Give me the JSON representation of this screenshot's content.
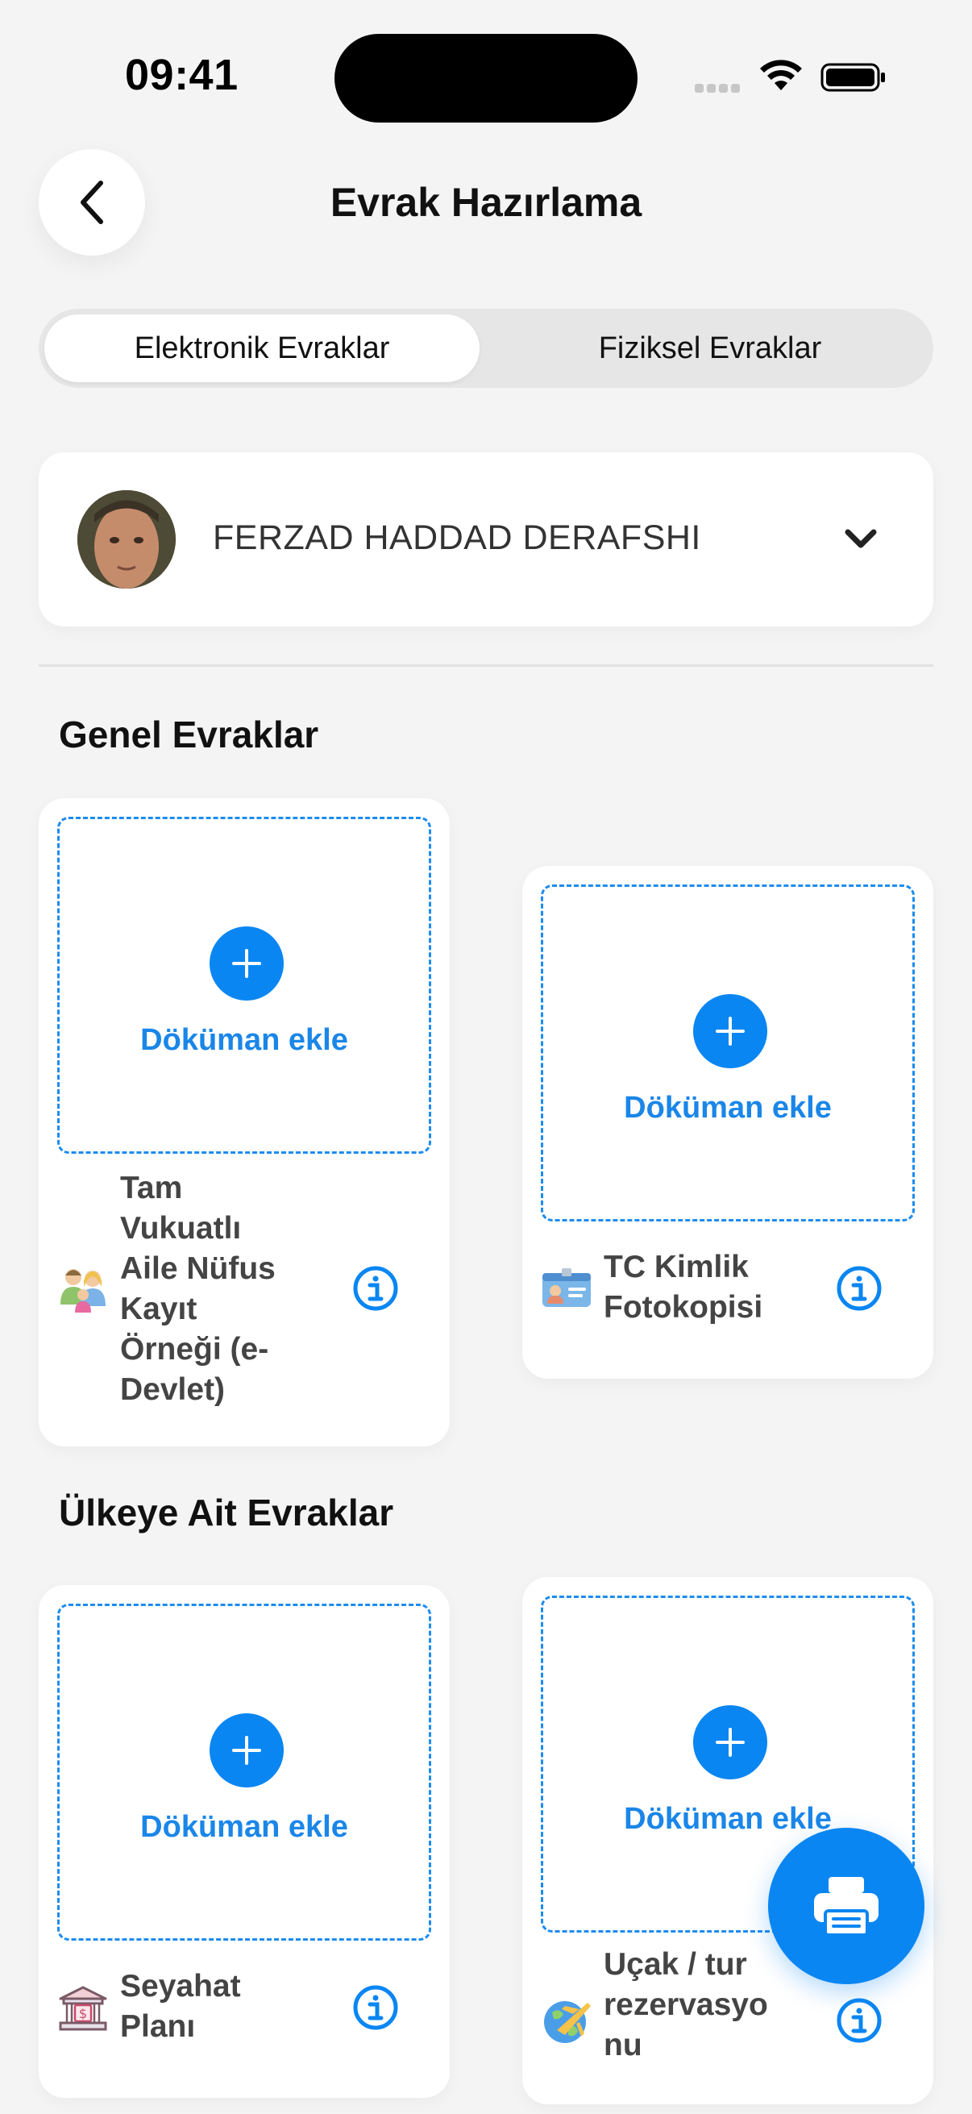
{
  "status_bar": {
    "time": "09:41"
  },
  "header": {
    "title": "Evrak Hazırlama"
  },
  "tabs": [
    {
      "label": "Elektronik Evraklar",
      "active": true
    },
    {
      "label": "Fiziksel Evraklar",
      "active": false
    }
  ],
  "person": {
    "name": "FERZAD HADDAD DERAFSHI"
  },
  "sections": {
    "general": {
      "title": "Genel Evraklar"
    },
    "country": {
      "title": "Ülkeye Ait Evraklar"
    }
  },
  "documents": [
    {
      "add_label": "Döküman ekle",
      "name_lines": [
        "Tam",
        "Vukuatlı",
        "Aile Nüfus",
        "Kayıt",
        "Örneği (e-",
        "Devlet)"
      ],
      "icon": "family-icon"
    },
    {
      "add_label": "Döküman ekle",
      "name_lines": [
        "TC Kimlik",
        "Fotokopisi"
      ],
      "icon": "id-card-icon"
    },
    {
      "add_label": "Döküman ekle",
      "name_lines": [
        "Seyahat",
        "Planı"
      ],
      "icon": "bank-icon"
    },
    {
      "add_label": "Döküman ekle",
      "name_lines": [
        "Uçak / tur",
        "rezervasyo",
        "nu"
      ],
      "icon": "globe-plane-icon"
    }
  ],
  "colors": {
    "accent": "#0a86f2",
    "background": "#f4f4f4",
    "card": "#ffffff"
  }
}
